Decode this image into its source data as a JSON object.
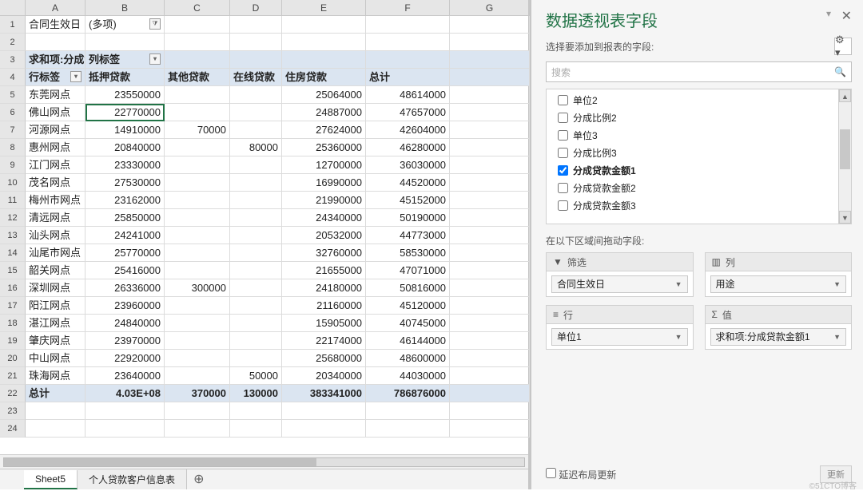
{
  "columns": [
    "",
    "A",
    "B",
    "C",
    "D",
    "E",
    "F",
    "G"
  ],
  "filter_row": {
    "label": "合同生效日",
    "value": "(多项)"
  },
  "pivot": {
    "row1": {
      "sum_label": "求和项:分成贷",
      "col_label": "列标签"
    },
    "row2": {
      "row_label": "行标签",
      "c1": "抵押贷款",
      "c2": "其他贷款",
      "c3": "在线贷款",
      "c4": "住房贷款",
      "c5": "总计"
    }
  },
  "chart_data": {
    "type": "table",
    "title": "求和项:分成贷款金额1",
    "row_field": "单位1",
    "col_field": "用途",
    "filter_field": "合同生效日",
    "columns": [
      "抵押贷款",
      "其他贷款",
      "在线贷款",
      "住房贷款",
      "总计"
    ],
    "rows": [
      {
        "label": "东莞网点",
        "v": [
          "23550000",
          "",
          "",
          "25064000",
          "48614000"
        ]
      },
      {
        "label": "佛山网点",
        "v": [
          "22770000",
          "",
          "",
          "24887000",
          "47657000"
        ]
      },
      {
        "label": "河源网点",
        "v": [
          "14910000",
          "70000",
          "",
          "27624000",
          "42604000"
        ]
      },
      {
        "label": "惠州网点",
        "v": [
          "20840000",
          "",
          "80000",
          "25360000",
          "46280000"
        ]
      },
      {
        "label": "江门网点",
        "v": [
          "23330000",
          "",
          "",
          "12700000",
          "36030000"
        ]
      },
      {
        "label": "茂名网点",
        "v": [
          "27530000",
          "",
          "",
          "16990000",
          "44520000"
        ]
      },
      {
        "label": "梅州市网点",
        "v": [
          "23162000",
          "",
          "",
          "21990000",
          "45152000"
        ]
      },
      {
        "label": "清远网点",
        "v": [
          "25850000",
          "",
          "",
          "24340000",
          "50190000"
        ]
      },
      {
        "label": "汕头网点",
        "v": [
          "24241000",
          "",
          "",
          "20532000",
          "44773000"
        ]
      },
      {
        "label": "汕尾市网点",
        "v": [
          "25770000",
          "",
          "",
          "32760000",
          "58530000"
        ]
      },
      {
        "label": "韶关网点",
        "v": [
          "25416000",
          "",
          "",
          "21655000",
          "47071000"
        ]
      },
      {
        "label": "深圳网点",
        "v": [
          "26336000",
          "300000",
          "",
          "24180000",
          "50816000"
        ]
      },
      {
        "label": "阳江网点",
        "v": [
          "23960000",
          "",
          "",
          "21160000",
          "45120000"
        ]
      },
      {
        "label": "湛江网点",
        "v": [
          "24840000",
          "",
          "",
          "15905000",
          "40745000"
        ]
      },
      {
        "label": "肇庆网点",
        "v": [
          "23970000",
          "",
          "",
          "22174000",
          "46144000"
        ]
      },
      {
        "label": "中山网点",
        "v": [
          "22920000",
          "",
          "",
          "25680000",
          "48600000"
        ]
      },
      {
        "label": "珠海网点",
        "v": [
          "23640000",
          "",
          "50000",
          "20340000",
          "44030000"
        ]
      }
    ],
    "total": {
      "label": "总计",
      "v": [
        "4.03E+08",
        "370000",
        "130000",
        "383341000",
        "786876000"
      ]
    }
  },
  "sheets": {
    "s1": "Sheet5",
    "s2": "个人贷款客户信息表"
  },
  "panel": {
    "title": "数据透视表字段",
    "subtitle": "选择要添加到报表的字段:",
    "search_placeholder": "搜索",
    "fields": [
      {
        "label": "单位2",
        "checked": false
      },
      {
        "label": "分成比例2",
        "checked": false
      },
      {
        "label": "单位3",
        "checked": false
      },
      {
        "label": "分成比例3",
        "checked": false
      },
      {
        "label": "分成贷款金额1",
        "checked": true
      },
      {
        "label": "分成贷款金额2",
        "checked": false
      },
      {
        "label": "分成贷款金额3",
        "checked": false
      }
    ],
    "area_label": "在以下区域间拖动字段:",
    "areas": {
      "filter": {
        "h": "筛选",
        "tag": "合同生效日"
      },
      "cols": {
        "h": "列",
        "tag": "用途"
      },
      "rows": {
        "h": "行",
        "tag": "单位1"
      },
      "vals": {
        "h": "值",
        "tag": "求和项:分成贷款金额1"
      }
    },
    "defer": "延迟布局更新",
    "update": "更新"
  },
  "watermark": "©51CTO博客"
}
